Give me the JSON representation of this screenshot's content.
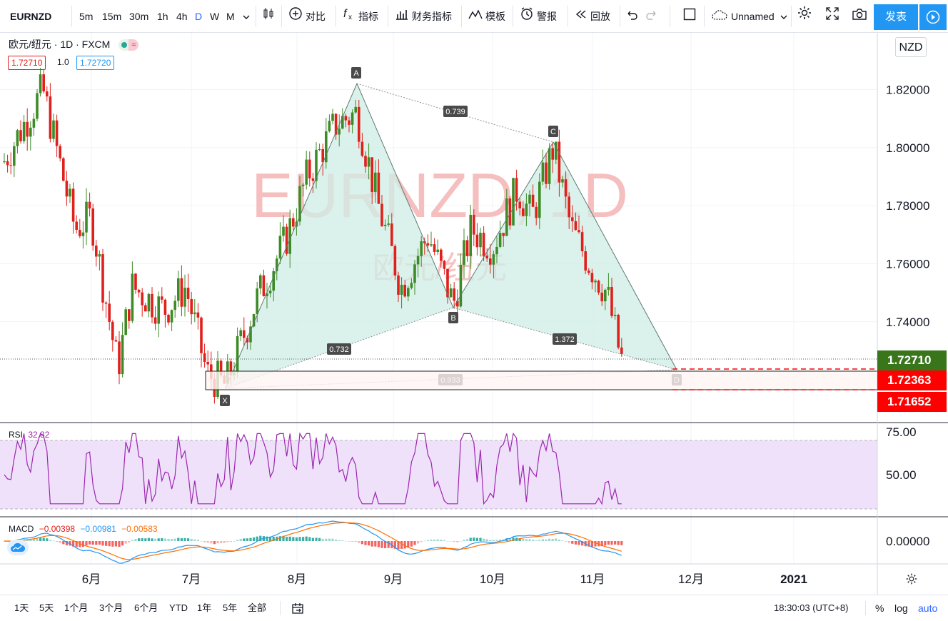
{
  "toolbar": {
    "symbol": "EURNZD",
    "intervals": [
      "5m",
      "15m",
      "30m",
      "1h",
      "4h",
      "D",
      "W",
      "M"
    ],
    "active_interval": "D",
    "compare_label": "对比",
    "indicators_label": "指标",
    "financials_label": "财务指标",
    "templates_label": "模板",
    "alert_label": "警报",
    "replay_label": "回放",
    "layout_name": "Unnamed",
    "publish_label": "发表"
  },
  "legend": {
    "title": "欧元/纽元 · 1D · FXCM",
    "bid": "1.72710",
    "spread": "1.0",
    "ask": "1.72720"
  },
  "currency_button": "NZD",
  "watermark": {
    "symbol": "EURNZD, 1D",
    "name": "欧元/纽元"
  },
  "price_axis": {
    "ticks": [
      "1.82000",
      "1.80000",
      "1.78000",
      "1.76000",
      "1.74000"
    ],
    "badges": [
      {
        "label": "1.72710",
        "color": "#39751b"
      },
      {
        "label": "1.72363",
        "color": "#ff0000"
      },
      {
        "label": "1.71652",
        "color": "#ff0000"
      }
    ]
  },
  "time_axis": {
    "ticks": [
      "6月",
      "7月",
      "8月",
      "9月",
      "10月",
      "11月",
      "12月",
      "2021"
    ]
  },
  "pattern": {
    "points": [
      "X",
      "A",
      "B",
      "C",
      "D"
    ],
    "ratios": {
      "xab": "0.732",
      "abc": "0.739",
      "bcd": "1.372",
      "xad": "0.933"
    }
  },
  "rsi": {
    "label": "RSI",
    "value": "32.82",
    "ticks": [
      "75.00",
      "50.00"
    ]
  },
  "macd": {
    "label": "MACD",
    "hist": "−0.00398",
    "macd": "−0.00981",
    "signal": "−0.00583",
    "ticks": [
      "0.00000"
    ]
  },
  "bottom": {
    "ranges": [
      "1天",
      "5天",
      "1个月",
      "3个月",
      "6个月",
      "YTD",
      "1年",
      "5年",
      "全部"
    ],
    "clock": "18:30:03 (UTC+8)",
    "pct": "%",
    "log": "log",
    "auto": "auto"
  },
  "colors": {
    "up": "#3d8b26",
    "down": "#e0201b",
    "accent": "#2962ff",
    "pattern_fill": "#cfeee6",
    "rsi_band": "#f0e1fb",
    "rsi_line": "#9c27b0",
    "macd_line": "#2196f3",
    "signal_line": "#ff6d00"
  }
}
